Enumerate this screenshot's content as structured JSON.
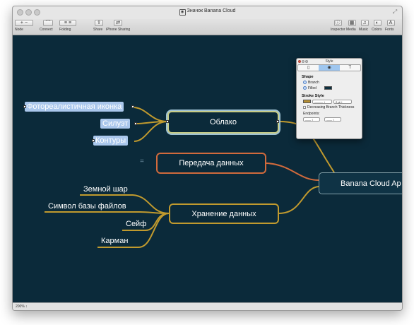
{
  "window": {
    "title": "Значок Banana Cloud",
    "doc_glyph": "◉"
  },
  "toolbar": {
    "items": [
      {
        "label": "Node",
        "glyphs": [
          "+",
          "−"
        ]
      },
      {
        "label": "Connect",
        "glyphs": [
          "⌒"
        ]
      },
      {
        "label": "Folding",
        "glyphs": [
          "≡",
          "≡"
        ]
      },
      {
        "label": "Share",
        "glyphs": [
          "⇪"
        ]
      },
      {
        "label": "iPhone Sharing",
        "glyphs": [
          "⇄"
        ]
      },
      {
        "label": "Inspector",
        "glyphs": [
          "ⓘ"
        ]
      },
      {
        "label": "Media",
        "glyphs": [
          "▦"
        ]
      },
      {
        "label": "Music",
        "glyphs": [
          "♫"
        ]
      },
      {
        "label": "Colors",
        "glyphs": [
          "◐"
        ]
      },
      {
        "label": "Fonts",
        "glyphs": [
          "A"
        ]
      }
    ]
  },
  "map": {
    "root": "Banana Cloud Ap",
    "cloud": "Облако",
    "transfer": "Передача данных",
    "storage": "Хранение данных",
    "cloud_children": [
      "Фотореалистичная иконка",
      "Силуэт",
      "Контуры"
    ],
    "storage_children": [
      "Земной шар",
      "Символ базы файлов",
      "Сейф",
      "Карман"
    ],
    "collapse_glyph": "="
  },
  "colors": {
    "canvas": "#0b2a3a",
    "cloud_border": "#c7cc86",
    "transfer_border": "#d16a3c",
    "storage_border": "#c19a2e",
    "selection": "#aac7ec"
  },
  "style_panel": {
    "title": "Style",
    "tabs": [
      "▯",
      "◉",
      "T"
    ],
    "shape_heading": "Shape",
    "branch": "Branch",
    "filled": "Filled",
    "stroke_heading": "Stroke Style",
    "stroke_line": "——— ↕",
    "stroke_width": "2 pt  ↕",
    "decreasing": "Decreasing Branch Thickness",
    "endpoints_heading": "Endpoints:",
    "endpoint_left": "—— ↕",
    "endpoint_right": "—— ↕"
  },
  "status": {
    "zoom": "200% ↕"
  }
}
